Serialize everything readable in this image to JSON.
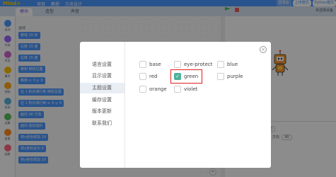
{
  "app": {
    "logo": "Mind+",
    "menu": [
      "项目",
      "教程",
      "方块设计"
    ],
    "top_right": [
      "登录后",
      "上传模式",
      "Python模式"
    ]
  },
  "tabs": [
    "模块",
    "造型",
    "声音"
  ],
  "stage_mode_label": "未选择设备",
  "categories": [
    {
      "label": "运动",
      "color": "#4c97ff"
    },
    {
      "label": "外观",
      "color": "#9966ff"
    },
    {
      "label": "声音",
      "color": "#cf63cf"
    },
    {
      "label": "事件",
      "color": "#ffbf00"
    },
    {
      "label": "控制",
      "color": "#ffab19"
    },
    {
      "label": "侦测",
      "color": "#5cb1d6"
    },
    {
      "label": "运算",
      "color": "#59c059"
    },
    {
      "label": "变量",
      "color": "#ff8c1a"
    },
    {
      "label": "函数",
      "color": "#ff6680"
    }
  ],
  "palette": {
    "title": "运动",
    "blocks": [
      "移动 10 步",
      "右转 15 度",
      "左转 15 度",
      "移到 随机位置",
      "移到 x: 0 y: 0",
      "在 1 秒内滑行到 随机位置",
      "在 1 秒内滑行到 x: 0 y: 0",
      "面向 90 方向",
      "面向 鼠标指针",
      "将x坐标增加 10",
      "将x坐标设为 0",
      "将y坐标增加 10"
    ]
  },
  "sprite_info": {
    "x_label": "x",
    "x_value": "0",
    "y_label": "y",
    "y_value": "0",
    "size_label": "大小",
    "size_value": "100",
    "direction_label": "方向",
    "direction_value": "90"
  },
  "modal": {
    "close": "×",
    "sidebar": [
      "语言设置",
      "显示设置",
      "主题设置",
      "缓存设置",
      "版本更新",
      "联系我们"
    ],
    "active_item": "主题设置",
    "themes": [
      {
        "name": "base",
        "checked": false
      },
      {
        "name": "eye-protect",
        "checked": false
      },
      {
        "name": "blue",
        "checked": false
      },
      {
        "name": "red",
        "checked": false
      },
      {
        "name": "green",
        "checked": true
      },
      {
        "name": "purple",
        "checked": false
      },
      {
        "name": "orange",
        "checked": false
      },
      {
        "name": "violet",
        "checked": false
      }
    ]
  }
}
